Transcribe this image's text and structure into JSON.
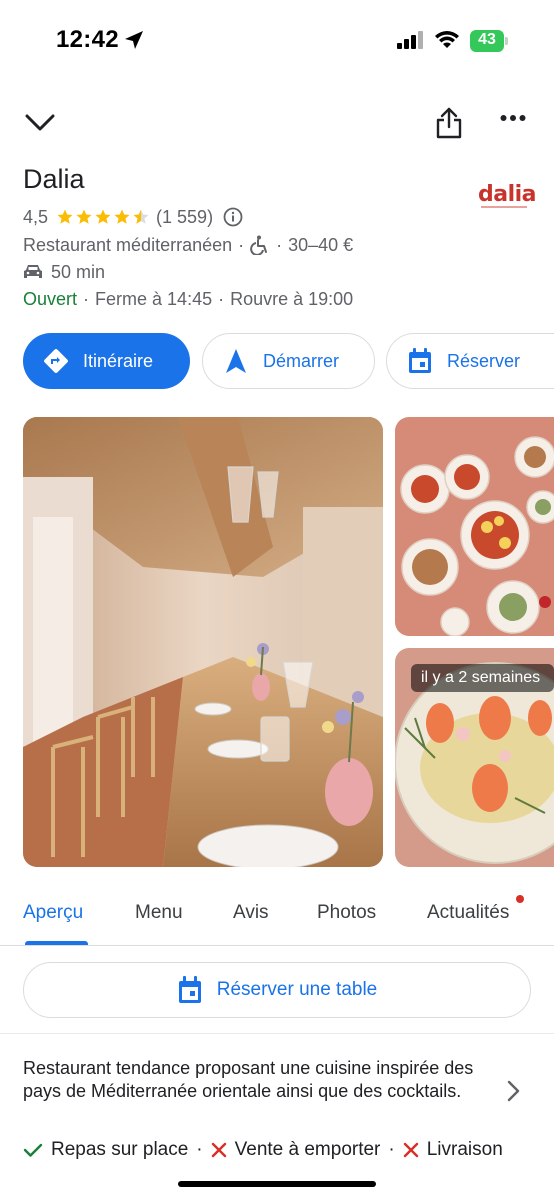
{
  "status_bar": {
    "time": "12:42",
    "battery": "43"
  },
  "place": {
    "name": "Dalia",
    "logo_text": "dalia",
    "rating": "4,5",
    "rating_stars": 4.5,
    "review_count": "(1 559)",
    "category": "Restaurant méditerranéen",
    "price": "30–40 €",
    "drive_time": "50 min",
    "open_status": "Ouvert",
    "closes": "Ferme à 14:45",
    "reopens": "Rouvre à 19:00"
  },
  "actions": {
    "itinerary": "Itinéraire",
    "start": "Démarrer",
    "reserve": "Réserver"
  },
  "photos": {
    "badge": "il y a 2 semaines"
  },
  "tabs": [
    {
      "label": "Aperçu"
    },
    {
      "label": "Menu"
    },
    {
      "label": "Avis"
    },
    {
      "label": "Photos"
    },
    {
      "label": "Actualités"
    }
  ],
  "reserve_table": {
    "label": "Réserver une table"
  },
  "description": "Restaurant tendance proposant une cuisine inspirée des pays de Méditerranée orientale ainsi que des cocktails.",
  "features": [
    {
      "label": "Repas sur place",
      "available": true
    },
    {
      "label": "Vente à emporter",
      "available": false
    },
    {
      "label": "Livraison",
      "available": false
    }
  ],
  "colors": {
    "accent": "#1a73e8",
    "open": "#188038",
    "star": "#fbbc04",
    "logo": "#c8342b",
    "unavailable": "#d93025",
    "available": "#188038"
  },
  "icons": {
    "back": "chevron-down-icon",
    "share": "share-icon",
    "more": "more-vert-icon",
    "info": "info-icon",
    "wheelchair": "wheelchair-icon",
    "car": "car-icon",
    "directions": "directions-icon",
    "navigation": "navigation-arrow-icon",
    "calendar": "calendar-icon",
    "chevron_right": "chevron-right-icon",
    "check": "check-icon",
    "cross": "cross-icon"
  }
}
